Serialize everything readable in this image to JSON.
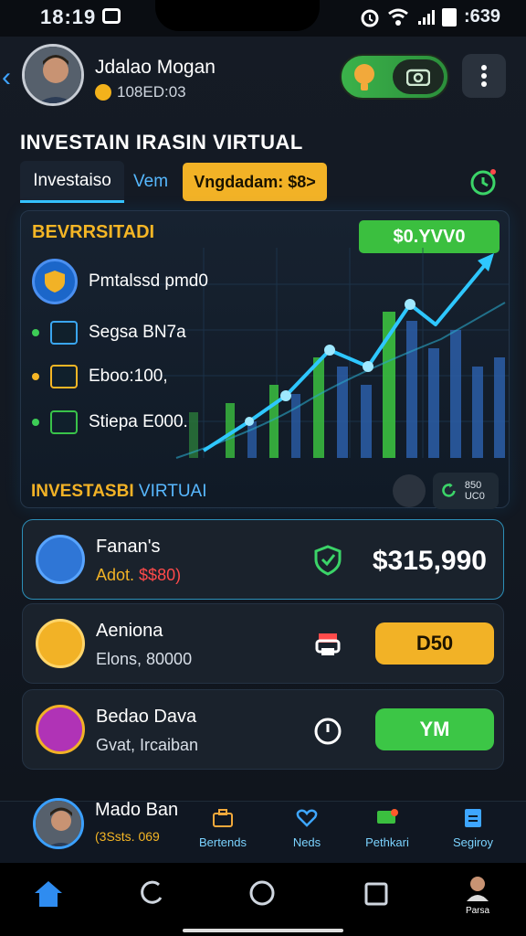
{
  "status": {
    "time": "18:19",
    "battery_text": ":639"
  },
  "profile": {
    "name": "Jdalao Mogan",
    "coins": "108ED:03"
  },
  "page_title": "INVESTAIN IRASIN VIRTUAL",
  "tabs": {
    "active": "Investaiso",
    "second": "Vem",
    "promo": "Vngdadam: $8>"
  },
  "chart_card": {
    "title": "BEVRRSITADI",
    "badge": "$0.YVV0",
    "shield_label": "Pmtalssd pmd0",
    "rows": [
      {
        "label": "Segsa BN7a",
        "color": "#3aa6f0"
      },
      {
        "label": "Eboo:100,",
        "color": "#f5b625"
      },
      {
        "label": "Stiepa E000.",
        "color": "#39c34a"
      }
    ],
    "line_color": "#2ec7ff",
    "bar_colors": [
      "#3bbf3f",
      "#2b5ea8"
    ]
  },
  "section2": {
    "title_main": "INVESTASBI",
    "title_sub": "VIRTUAI",
    "chip_text": "850 UC0"
  },
  "cards": [
    {
      "title": "Fanan's",
      "sub_main": "Adot.",
      "sub_red": "$$80)",
      "value": "$315,990",
      "icon_color": "#2f76d6",
      "action": ""
    },
    {
      "title": "Aeniona",
      "sub_main": "Elons, 80000",
      "sub_red": "",
      "value": "",
      "icon_color": "#f2b226",
      "action": "D50",
      "action_color": "#f2b226"
    },
    {
      "title": "Bedao Dava",
      "sub_main": "Gvat, Ircaiban",
      "sub_red": "",
      "value": "",
      "icon_color": "#b033b6",
      "action": "YM",
      "action_color": "#3cc646"
    }
  ],
  "bottom_nav": {
    "user_name": "Mado Ban",
    "user_sub": "(3Ssts. 069",
    "items": [
      {
        "label": "Bertends",
        "icon": "briefcase-icon"
      },
      {
        "label": "Neds",
        "icon": "heart-icon"
      },
      {
        "label": "Pethkari",
        "icon": "chat-icon"
      },
      {
        "label": "Segiroy",
        "icon": "document-icon"
      }
    ]
  },
  "system_nav": {
    "profile_label": "Parsa"
  }
}
